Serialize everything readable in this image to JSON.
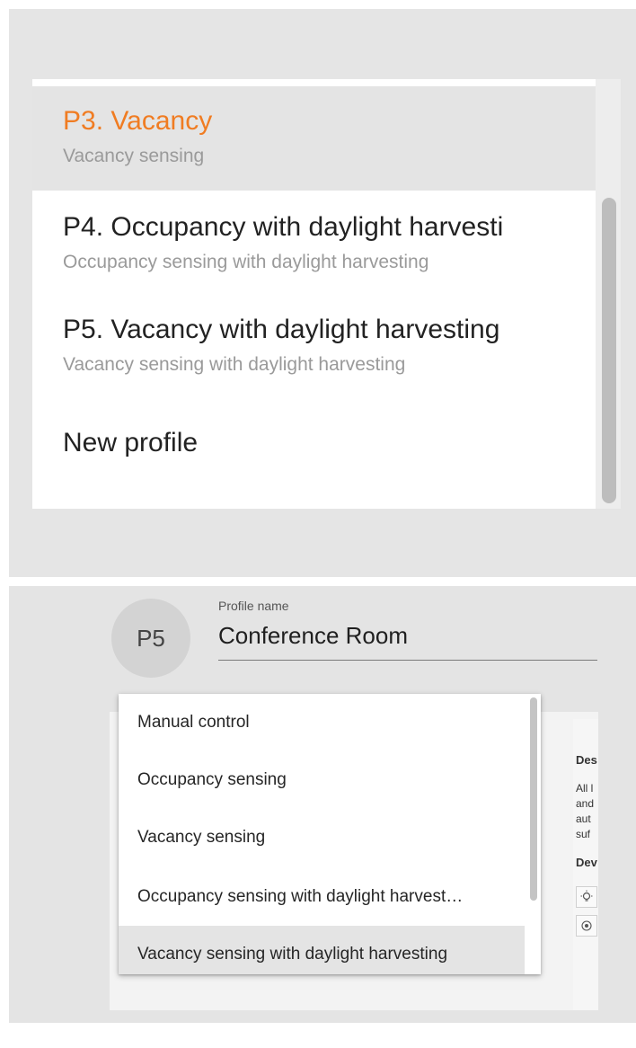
{
  "profile_list": {
    "items": [
      {
        "title": "P3. Vacancy",
        "subtitle": "Vacancy sensing"
      },
      {
        "title": "P4. Occupancy with daylight harvesti",
        "subtitle": "Occupancy sensing with daylight harvesting"
      },
      {
        "title": "P5. Vacancy with daylight harvesting",
        "subtitle": "Vacancy sensing with daylight harvesting"
      },
      {
        "title": "New profile"
      }
    ],
    "selected_index": 0,
    "accent_color": "#f07c22"
  },
  "profile_editor": {
    "avatar_text": "P5",
    "name_label": "Profile name",
    "name_value": "Conference Room"
  },
  "dropdown": {
    "options": [
      "Manual control",
      "Occupancy sensing",
      "Vacancy sensing",
      "Occupancy sensing with daylight harvest…",
      "Vacancy sensing with daylight harvesting"
    ],
    "selected_index": 4
  },
  "description_panel": {
    "heading": "Des",
    "lines": [
      "All l",
      "and",
      "aut",
      "suf"
    ],
    "devices_heading": "Dev",
    "device_icons": [
      "light-bulb-icon",
      "sensor-icon"
    ]
  }
}
